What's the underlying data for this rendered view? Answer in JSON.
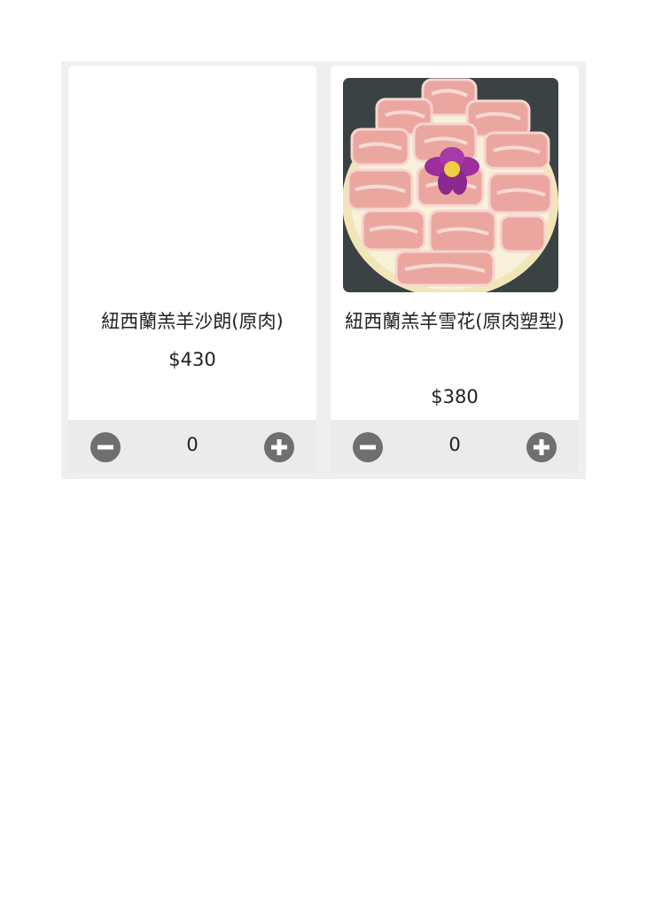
{
  "products": [
    {
      "name": "紐西蘭羔羊沙朗(原肉)",
      "price": "$430",
      "quantity": "0",
      "image": "none"
    },
    {
      "name": "紐西蘭羔羊雪花(原肉塑型)",
      "price": "$380",
      "quantity": "0",
      "image": "sliced-lamb-platter"
    }
  ],
  "icons": {
    "minus": "minus-circle-icon",
    "plus": "plus-circle-icon"
  },
  "colors": {
    "button": "#6f6f6f",
    "qty_bar": "#ebebeb",
    "grid_bg": "#efefef"
  }
}
